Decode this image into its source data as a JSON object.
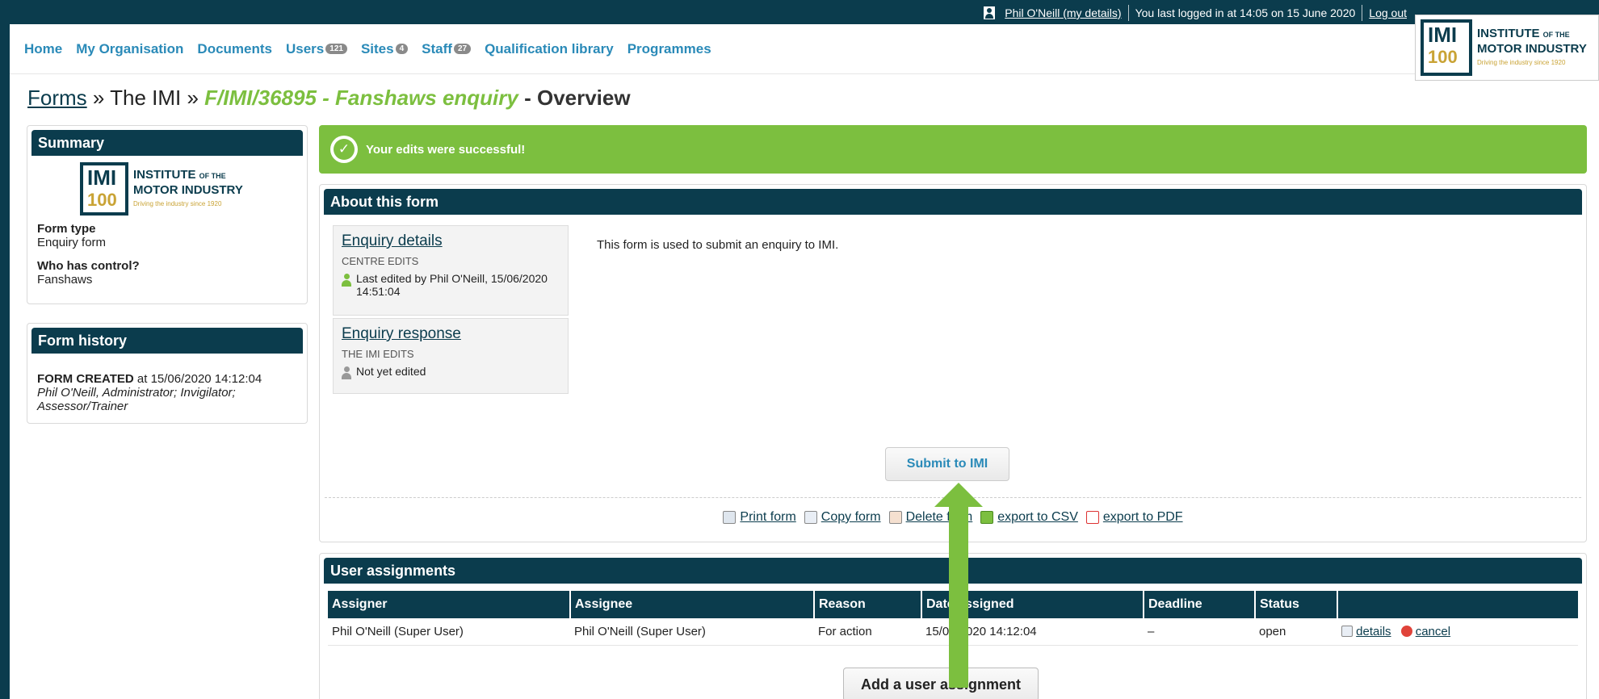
{
  "topbar": {
    "user_name": "Phil O'Neill",
    "my_details": "(my details)",
    "last_login": "You last logged in at 14:05 on 15 June 2020",
    "logout": "Log out"
  },
  "nav": [
    {
      "label": "Home"
    },
    {
      "label": "My Organisation"
    },
    {
      "label": "Documents"
    },
    {
      "label": "Users",
      "count": "121"
    },
    {
      "label": "Sites",
      "count": "4"
    },
    {
      "label": "Staff",
      "count": "27"
    },
    {
      "label": "Qualification library"
    },
    {
      "label": "Programmes"
    }
  ],
  "logo": {
    "mark_top": "IMI",
    "mark_bottom": "100",
    "line1": "INSTITUTE",
    "of_the": "OF THE",
    "line2": "MOTOR INDUSTRY",
    "tagline": "Driving the industry since 1920"
  },
  "breadcrumb": {
    "forms": "Forms",
    "sep1": " » ",
    "org": "The IMI",
    "sep2": " » ",
    "current": "F/IMI/36895 - Fanshaws enquiry",
    "suffix": " - Overview"
  },
  "summary": {
    "title": "Summary",
    "form_type_label": "Form type",
    "form_type": "Enquiry form",
    "control_label": "Who has control?",
    "control": "Fanshaws"
  },
  "history": {
    "title": "Form history",
    "event": "FORM CREATED",
    "at": " at 15/06/2020 14:12:04",
    "by": "Phil O'Neill, Administrator; Invigilator; Assessor/Trainer"
  },
  "success": {
    "message": "Your edits were successful!",
    "color": "#7cbf3f"
  },
  "about": {
    "title": "About this form",
    "description": "This form is used to submit an enquiry to IMI.",
    "sections": [
      {
        "title": "Enquiry details",
        "editor": "CENTRE EDITS",
        "status": "Last edited by Phil O'Neill, 15/06/2020 14:51:04"
      },
      {
        "title": "Enquiry response",
        "editor": "THE IMI EDITS",
        "status": "Not yet edited"
      }
    ],
    "submit": "Submit to IMI",
    "actions": {
      "print": "Print form",
      "copy": "Copy form",
      "delete": "Delete form",
      "csv": "export to CSV",
      "pdf": "export to PDF"
    }
  },
  "assignments": {
    "title": "User assignments",
    "columns": [
      "Assigner",
      "Assignee",
      "Reason",
      "Date assigned",
      "Deadline",
      "Status",
      ""
    ],
    "rows": [
      {
        "assigner": "Phil O'Neill (Super User)",
        "assignee": "Phil O'Neill (Super User)",
        "reason": "For action",
        "date": "15/06/2020 14:12:04",
        "deadline": "–",
        "status": "open",
        "details": "details",
        "cancel": "cancel"
      }
    ],
    "add_button": "Add a user assignment"
  },
  "colors": {
    "header": "#0b3c4d",
    "accent_green": "#7cbf3f",
    "link": "#2a8ab8"
  }
}
